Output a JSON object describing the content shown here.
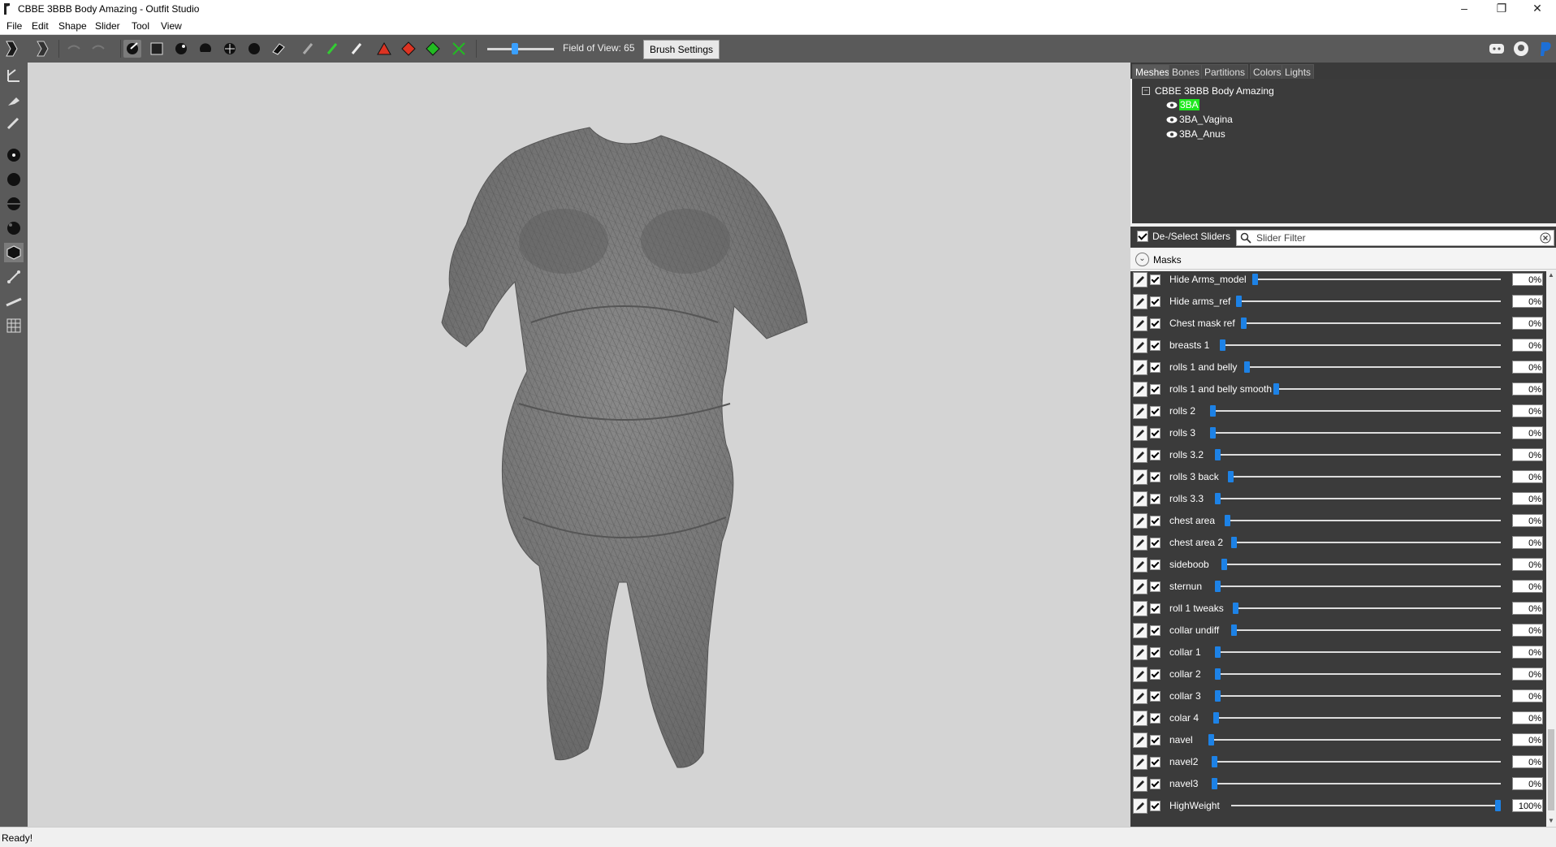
{
  "window": {
    "title": "CBBE 3BBB Body Amazing - Outfit Studio"
  },
  "menu": [
    "File",
    "Edit",
    "Shape",
    "Slider",
    "Tool",
    "View"
  ],
  "toolbar": {
    "fov_label": "Field of View: 65",
    "fov_value": 65,
    "brush_settings_label": "Brush Settings"
  },
  "panel_tabs": [
    "Meshes",
    "Bones",
    "Partitions",
    "Colors",
    "Lights"
  ],
  "mesh_tree": {
    "root": "CBBE 3BBB Body Amazing",
    "meshes": [
      "3BA",
      "3BA_Vagina",
      "3BA_Anus"
    ]
  },
  "slider_toolbar": {
    "deselect_label": "De-/Select Sliders",
    "filter_placeholder": "Slider Filter"
  },
  "masks_label": "Masks",
  "sliders": [
    {
      "name": "Hide Arms_model",
      "value": "0%",
      "level": 0
    },
    {
      "name": "Hide arms_ref",
      "value": "0%",
      "level": 0
    },
    {
      "name": "Chest mask ref",
      "value": "0%",
      "level": 0
    },
    {
      "name": "breasts 1",
      "value": "0%",
      "level": 0
    },
    {
      "name": "rolls 1 and belly",
      "value": "0%",
      "level": 0
    },
    {
      "name": "rolls 1 and belly smooth",
      "value": "0%",
      "level": 0
    },
    {
      "name": "rolls 2",
      "value": "0%",
      "level": 0
    },
    {
      "name": "rolls 3",
      "value": "0%",
      "level": 0
    },
    {
      "name": "rolls 3.2",
      "value": "0%",
      "level": 0
    },
    {
      "name": "rolls 3 back",
      "value": "0%",
      "level": 0
    },
    {
      "name": "rolls 3.3",
      "value": "0%",
      "level": 0
    },
    {
      "name": "chest area",
      "value": "0%",
      "level": 0
    },
    {
      "name": "chest area 2",
      "value": "0%",
      "level": 0
    },
    {
      "name": "sideboob",
      "value": "0%",
      "level": 0
    },
    {
      "name": "sternun",
      "value": "0%",
      "level": 0
    },
    {
      "name": "roll 1 tweaks",
      "value": "0%",
      "level": 0
    },
    {
      "name": "collar undiff",
      "value": "0%",
      "level": 0
    },
    {
      "name": "collar 1",
      "value": "0%",
      "level": 0
    },
    {
      "name": "collar 2",
      "value": "0%",
      "level": 0
    },
    {
      "name": "collar 3",
      "value": "0%",
      "level": 0
    },
    {
      "name": "colar 4",
      "value": "0%",
      "level": 0
    },
    {
      "name": "navel",
      "value": "0%",
      "level": 0
    },
    {
      "name": "navel2",
      "value": "0%",
      "level": 0
    },
    {
      "name": "navel3",
      "value": "0%",
      "level": 0
    },
    {
      "name": "HighWeight",
      "value": "100%",
      "level": 1
    }
  ],
  "status": {
    "text": "Ready!"
  },
  "colors": {
    "accent": "#1d82e6",
    "highlight": "#1ee81e",
    "dark_panel": "#3b3b3b",
    "toolbar": "#5a5a5a"
  }
}
